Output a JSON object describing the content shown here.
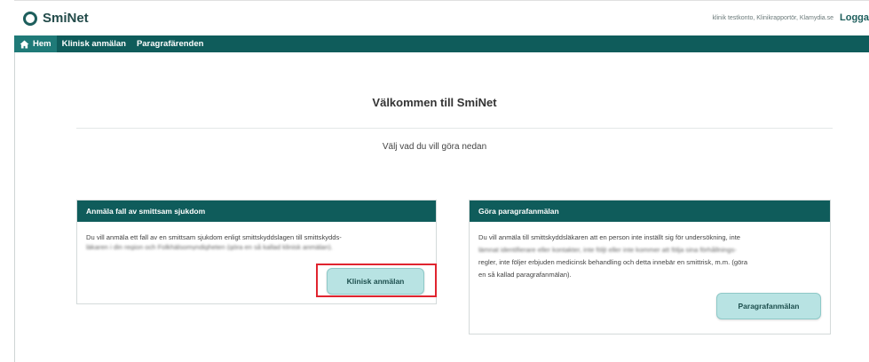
{
  "header": {
    "app_name": "SmiNet",
    "user_info": "klinik testkonto, Klinikrapportör, Klamydia.se",
    "logout_label": "Logga"
  },
  "nav": {
    "items": [
      {
        "label": "Hem",
        "icon": "home-icon",
        "active": true
      },
      {
        "label": "Klinisk anmälan",
        "active": false
      },
      {
        "label": "Paragrafärenden",
        "active": false
      }
    ]
  },
  "main": {
    "title": "Välkommen till SmiNet",
    "subtitle": "Välj vad du vill göra nedan"
  },
  "cards": {
    "left": {
      "header": "Anmäla fall av smittsam sjukdom",
      "line1": "Du vill anmäla ett fall av en smittsam sjukdom enligt smittskyddslagen till smittskydds-",
      "line2": "läkaren i din region och Folkhälsomyndigheten (göra en så kallad klinisk anmälan).",
      "button": "Klinisk anmälan"
    },
    "right": {
      "header": "Göra paragrafanmälan",
      "line1": "Du vill anmäla till smittskyddsläkaren att en person inte inställt sig för undersökning, inte",
      "line2": "lämnat identifierare eller kontakter, inte följt eller inte kommer att följa sina förhållnings-",
      "line3": "regler, inte följer erbjuden medicinsk behandling och detta innebär en smittrisk, m.m. (göra",
      "line4": "en så kallad paragrafanmälan).",
      "button": "Paragrafanmälan"
    }
  },
  "colors": {
    "primary": "#0f5c5b",
    "nav_active": "#1f7a78",
    "button_bg": "#b8e3e3",
    "highlight": "#e0242f"
  }
}
